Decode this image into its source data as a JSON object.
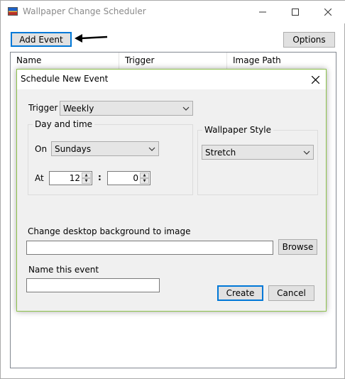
{
  "window": {
    "title": "Wallpaper Change Scheduler"
  },
  "toolbar": {
    "add_event_label": "Add Event",
    "options_label": "Options"
  },
  "list": {
    "columns": [
      "Name",
      "Trigger",
      "Image Path"
    ]
  },
  "dialog": {
    "title": "Schedule New Event",
    "trigger_label": "Trigger",
    "trigger_value": "Weekly",
    "day_time_group": "Day and time",
    "on_label": "On",
    "on_value": "Sundays",
    "at_label": "At",
    "hour_value": "12",
    "colon": ":",
    "minute_value": "0",
    "style_group": "Wallpaper Style",
    "style_value": "Stretch",
    "image_label": "Change desktop background to image",
    "image_value": "",
    "browse_label": "Browse",
    "name_label": "Name this event",
    "name_value": "",
    "create_label": "Create",
    "cancel_label": "Cancel"
  },
  "colors": {
    "accent": "#0078d7",
    "dialog_border": "#8dc24c",
    "dialog_bg": "#f0f0f0"
  }
}
